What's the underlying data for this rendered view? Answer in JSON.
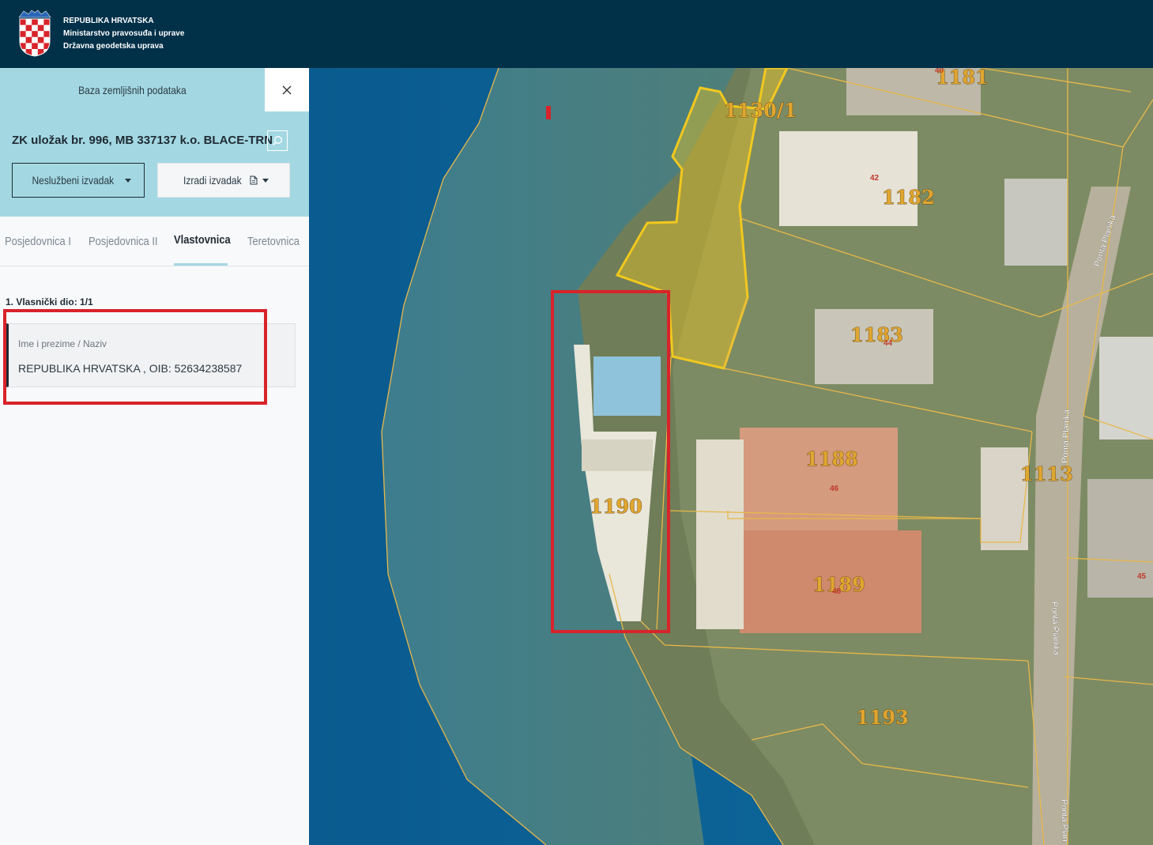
{
  "header": {
    "line1": "REPUBLIKA HRVATSKA",
    "line2": "Ministarstvo pravosuđa i uprave",
    "line3": "Državna geodetska uprava"
  },
  "panel": {
    "title": "Baza zemljišnih podataka",
    "record_title": "ZK uložak br. 996, MB 337137 k.o. BLACE-TRN",
    "btn_unofficial": "Neslužbeni izvadak",
    "btn_create": "Izradi izvadak"
  },
  "tabs": [
    {
      "label": "Posjedovnica I"
    },
    {
      "label": "Posjedovnica II"
    },
    {
      "label": "Vlastovnica"
    },
    {
      "label": "Teretovnica"
    }
  ],
  "ownership": {
    "share_label": "1. Vlasnički dio: 1/1",
    "name_label": "Ime i prezime / Naziv",
    "owner": "REPUBLIKA HRVATSKA , OIB: 52634238587"
  },
  "map": {
    "parcels": [
      "1181",
      "1130/1",
      "1182",
      "1183",
      "1188",
      "1190",
      "1113",
      "1189",
      "1193"
    ],
    "house_numbers": [
      "40",
      "42",
      "44",
      "46",
      "48",
      "45"
    ],
    "streets": [
      "Ponta Planika",
      "Ponta Planika",
      "Ponta Planika",
      "Ponta Plan"
    ]
  },
  "colors": {
    "header_bg": "#013049",
    "panel_accent": "#a3d8e3",
    "highlight": "#d8232a",
    "parcel_line": "#e8b84a",
    "selected_parcel": "#f2c81e"
  }
}
